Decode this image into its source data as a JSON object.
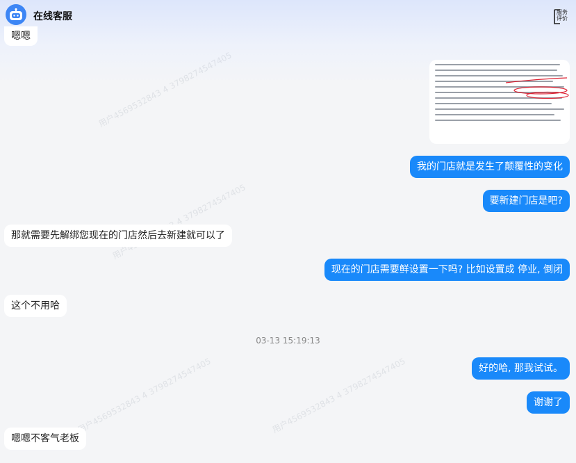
{
  "header": {
    "title": "在线客服",
    "service_label": "服务评价",
    "service_line1": "服务",
    "service_line2": "评价"
  },
  "messages": {
    "m0": "嗯嗯",
    "m2": "我的门店就是发生了颠覆性的变化",
    "m3": "要新建门店是吧?",
    "m4": "那就需要先解绑您现在的门店然后去新建就可以了",
    "m5": "现在的门店需要鲜设置一下吗? 比如设置成 停业, 倒闭",
    "m6": "这个不用哈",
    "m7": "好的哈, 那我试试。",
    "m8": "谢谢了",
    "m9": "嗯嗯不客气老板"
  },
  "timestamp": "03-13 15:19:13",
  "watermark": "用户4569532843 4 3798274547405",
  "colors": {
    "accent": "#1989fa",
    "incoming": "#ffffff",
    "background": "#f4f5f7"
  },
  "icons": {
    "avatar": "robot-icon",
    "service": "service-evaluation-icon"
  }
}
